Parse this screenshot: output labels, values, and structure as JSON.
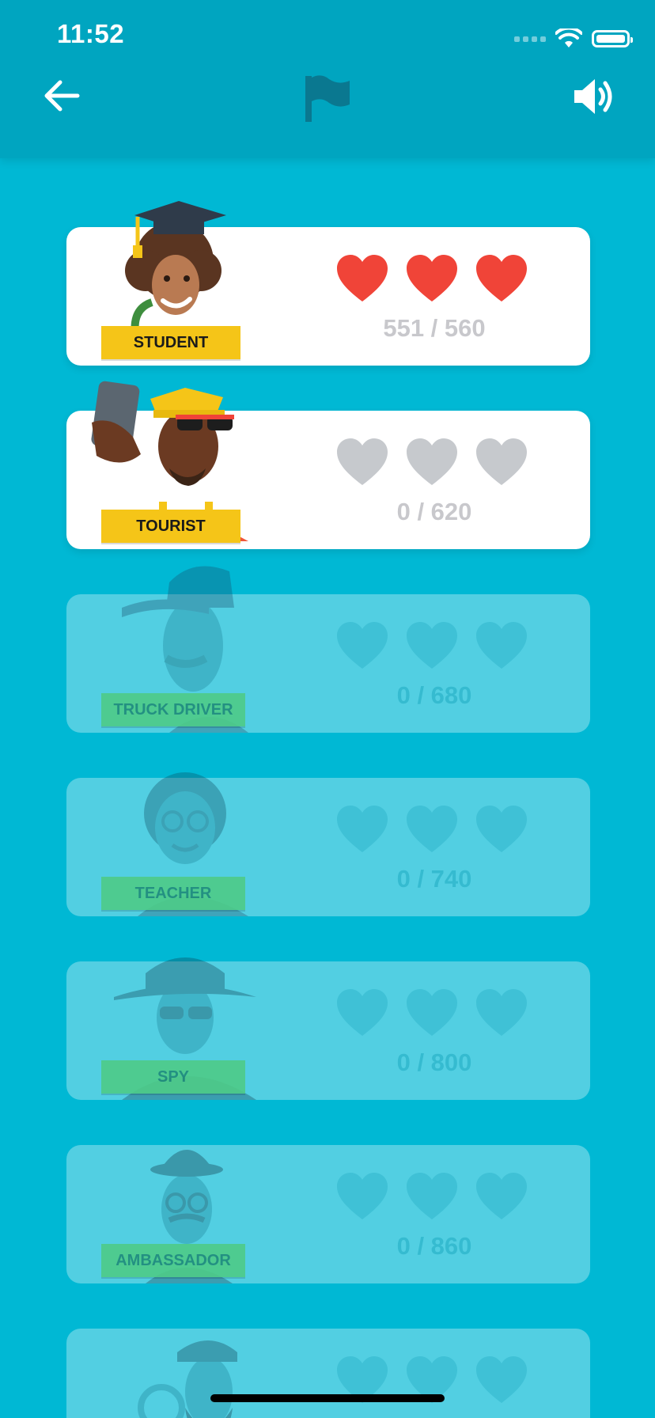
{
  "status_bar": {
    "time": "11:52"
  },
  "header": {
    "back_icon": "arrow-left-icon",
    "flag_icon": "flag-icon",
    "sound_icon": "speaker-icon"
  },
  "colors": {
    "background": "#00b8d4",
    "header": "#00a5c0",
    "heart_full": "#f04438",
    "heart_empty": "#c6c9cd",
    "label_unlocked": "#f5c518",
    "label_locked": "#4ecb88"
  },
  "levels": [
    {
      "label": "STUDENT",
      "score": "551 / 560",
      "hearts_filled": 3,
      "locked": false
    },
    {
      "label": "TOURIST",
      "score": "0 / 620",
      "hearts_filled": 0,
      "locked": false
    },
    {
      "label": "TRUCK DRIVER",
      "score": "0 / 680",
      "hearts_filled": 0,
      "locked": true
    },
    {
      "label": "TEACHER",
      "score": "0 / 740",
      "hearts_filled": 0,
      "locked": true
    },
    {
      "label": "SPY",
      "score": "0 / 800",
      "hearts_filled": 0,
      "locked": true
    },
    {
      "label": "AMBASSADOR",
      "score": "0 / 860",
      "hearts_filled": 0,
      "locked": true
    },
    {
      "label": "",
      "score": "",
      "hearts_filled": 0,
      "locked": true
    }
  ]
}
